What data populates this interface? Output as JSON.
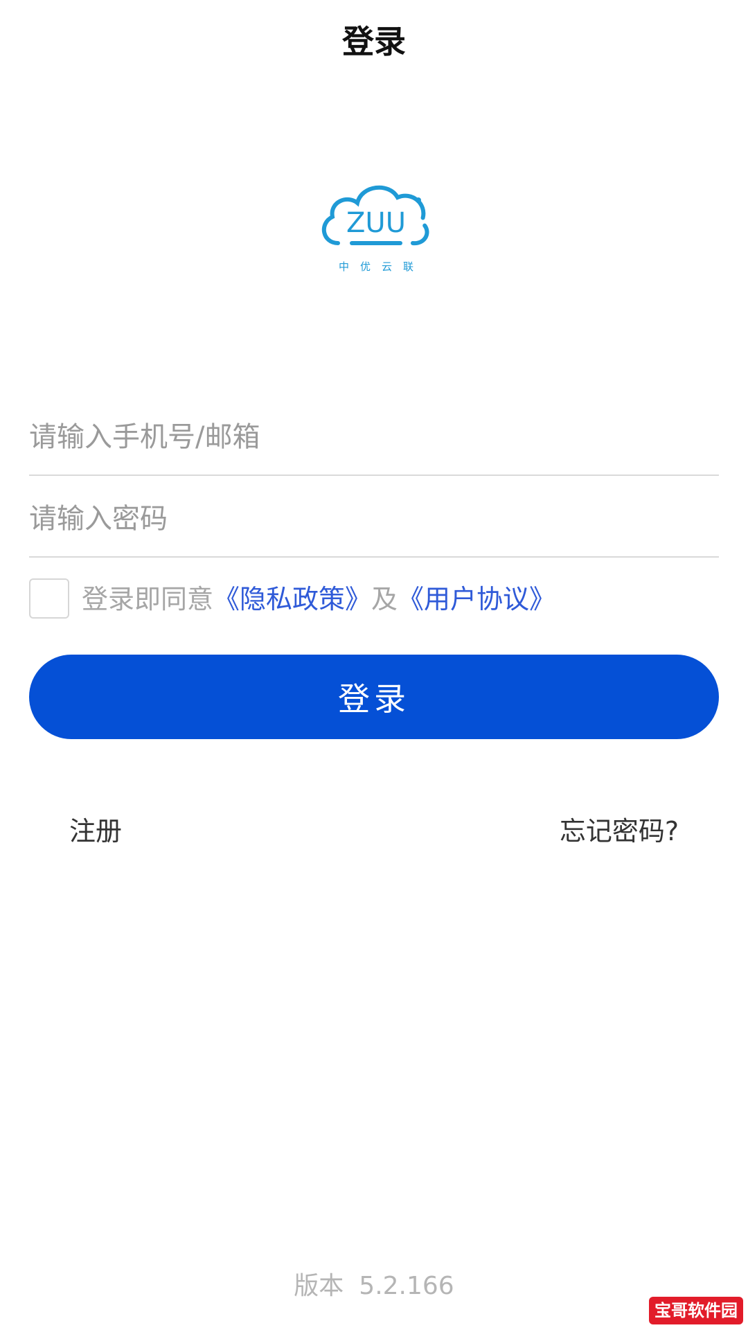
{
  "header": {
    "title": "登录"
  },
  "logo": {
    "text": "ZUU",
    "tagline": "中优云联"
  },
  "form": {
    "phone_placeholder": "请输入手机号/邮箱",
    "password_placeholder": "请输入密码",
    "agreement": {
      "checked": false,
      "prefix": "登录即同意",
      "privacy_link": "《隐私政策》",
      "conjunction": "及",
      "terms_link": "《用户协议》"
    },
    "login_button_label": "登录"
  },
  "links": {
    "register": "注册",
    "forgot_password": "忘记密码?"
  },
  "footer": {
    "version_label": "版本",
    "version_number": "5.2.166"
  },
  "watermark": {
    "text": "宝哥软件园"
  },
  "colors": {
    "primary": "#0550d6",
    "link": "#2f5ad8",
    "logo": "#1f9ad6",
    "watermark": "#e21c2a"
  }
}
